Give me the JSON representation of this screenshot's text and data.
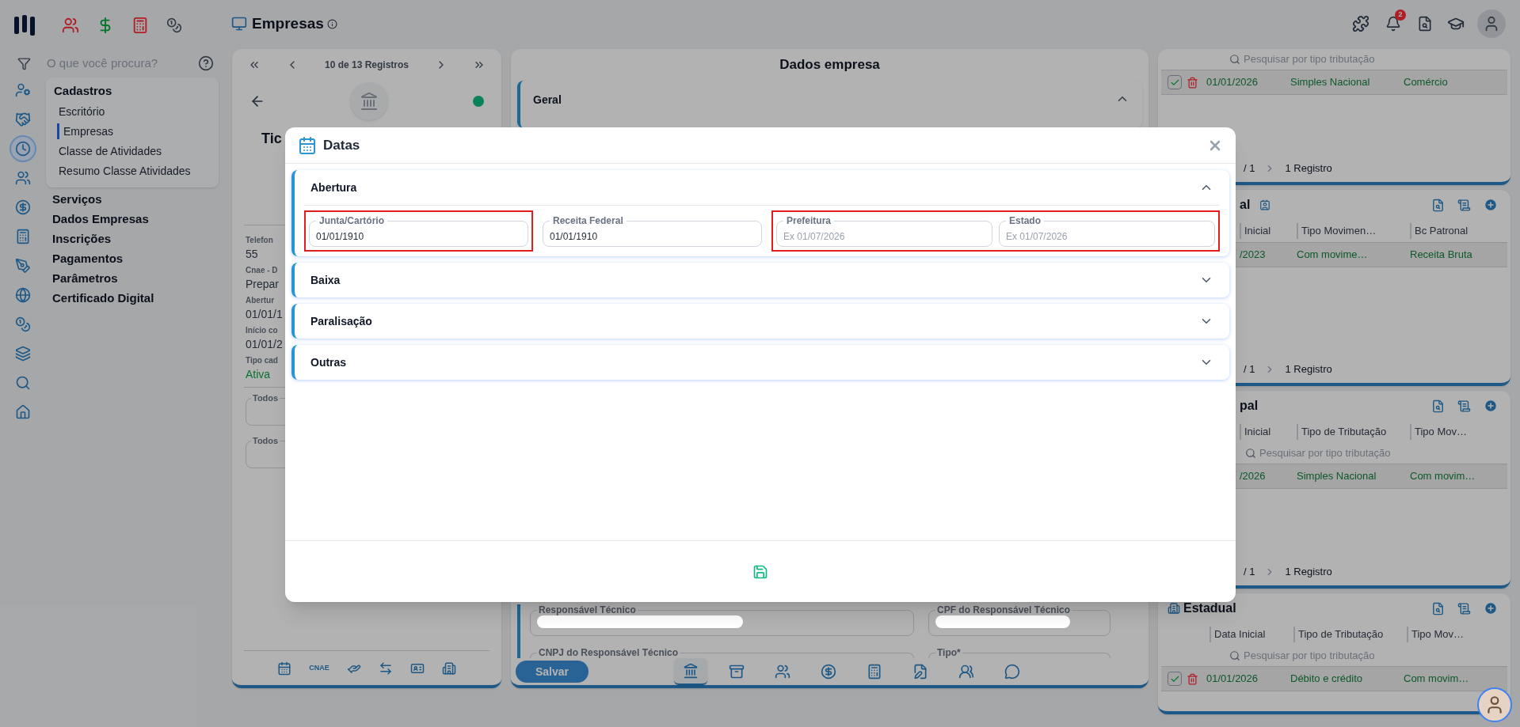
{
  "top_bar": {
    "title": "Empresas",
    "notifications": "2"
  },
  "sidebar": {
    "search_placeholder": "O que você procura?",
    "nav_rail": [
      {
        "kind": "user-gear",
        "selected": false
      },
      {
        "kind": "handshake",
        "selected": false
      },
      {
        "kind": "clock",
        "selected": true
      },
      {
        "kind": "users",
        "selected": false
      },
      {
        "kind": "dollar",
        "selected": false
      },
      {
        "kind": "calculator",
        "selected": false
      },
      {
        "kind": "pen",
        "selected": false
      },
      {
        "kind": "globe",
        "selected": false
      },
      {
        "kind": "coins",
        "selected": false
      },
      {
        "kind": "layers",
        "selected": false
      },
      {
        "kind": "search",
        "selected": false
      },
      {
        "kind": "home",
        "selected": false
      }
    ],
    "menu": [
      {
        "label": "Cadastros",
        "expanded": true,
        "children": [
          {
            "label": "Escritório",
            "selected": false
          },
          {
            "label": "Empresas",
            "selected": true
          },
          {
            "label": "Classe de Atividades",
            "selected": false
          },
          {
            "label": "Resumo Classe Atividades",
            "selected": false
          }
        ]
      },
      {
        "label": "Serviços",
        "expanded": false
      },
      {
        "label": "Dados Empresas",
        "expanded": false
      },
      {
        "label": "Inscrições",
        "expanded": false
      },
      {
        "label": "Pagamentos",
        "expanded": false
      },
      {
        "label": "Parâmetros",
        "expanded": false
      },
      {
        "label": "Certificado Digital",
        "expanded": false
      }
    ]
  },
  "record_panel": {
    "pager": "10 de 13 Registros",
    "active": true,
    "title": "Tic",
    "info": [
      {
        "label": "Telefon",
        "value": "55",
        "kind": "text"
      },
      {
        "label": "Cnae - D",
        "value": "Prepar",
        "kind": "text"
      },
      {
        "label": "Abertur",
        "value": "01/01/1",
        "kind": "text"
      },
      {
        "label": "Início co",
        "value": "01/01/2",
        "kind": "text"
      },
      {
        "label": "Tipo cad",
        "value": "Ativa",
        "kind": "status"
      }
    ],
    "filters": [
      "Todos",
      "Todos"
    ],
    "toolbar": [
      {
        "kind": "calendar"
      },
      {
        "kind": "text",
        "label": "CNAE"
      },
      {
        "kind": "hand"
      },
      {
        "kind": "transfer"
      },
      {
        "kind": "card"
      },
      {
        "kind": "building"
      }
    ]
  },
  "main_panel": {
    "title": "Dados empresa",
    "sections": [
      {
        "title": "Geral",
        "expanded": true
      }
    ],
    "fields": [
      {
        "label": "Responsável Técnico",
        "redacted": true
      },
      {
        "label": "CPF do Responsável Técnico",
        "redacted": true
      },
      {
        "label": "CNPJ do Responsável Técnico",
        "redacted": false
      },
      {
        "label": "Tipo*",
        "redacted": false
      }
    ],
    "save_button": "Salvar",
    "tabs": [
      {
        "kind": "bank",
        "selected": true
      },
      {
        "kind": "register",
        "selected": false
      },
      {
        "kind": "users",
        "selected": false
      },
      {
        "kind": "dollar",
        "selected": false
      },
      {
        "kind": "calculator",
        "selected": false
      },
      {
        "kind": "doc",
        "selected": false
      },
      {
        "kind": "group",
        "selected": false
      },
      {
        "kind": "chat",
        "selected": false
      }
    ]
  },
  "right_panels": [
    {
      "search_placeholder": "Pesquisar por tipo tributação",
      "rows": [
        {
          "checked": true,
          "cells": [
            "01/01/2026",
            "Simples Nacional",
            "Comércio"
          ]
        }
      ],
      "pages": "/ 1",
      "count": "1 Registro"
    },
    {
      "title": "al",
      "columns": [
        "Inicial",
        "Tipo Movimen…",
        "Bc Patronal"
      ],
      "rows": [
        {
          "cells": [
            "/2023",
            "Com movime…",
            "Receita Bruta"
          ]
        }
      ],
      "pages": "/ 1",
      "count": "1 Registro"
    },
    {
      "title": "pal",
      "columns": [
        "Inicial",
        "Tipo de Tributação",
        "Tipo Mov…"
      ],
      "search_placeholder": "Pesquisar por tipo tributação",
      "rows": [
        {
          "cells": [
            "/2026",
            "Simples Nacional",
            "Com movim…"
          ]
        }
      ],
      "pages": "/ 1",
      "count": "1 Registro"
    },
    {
      "title": "Estadual",
      "columns": [
        "Data Inicial",
        "Tipo de Tributação",
        "Tipo Mov…"
      ],
      "search_placeholder": "Pesquisar por tipo tributação",
      "rows": [
        {
          "checked": true,
          "cells": [
            "01/01/2026",
            "Débito e crédito",
            "Com movim…"
          ]
        }
      ]
    }
  ],
  "dialog": {
    "title": "Datas",
    "sections": [
      {
        "title": "Abertura",
        "expanded": true,
        "field_groups": [
          {
            "highlighted": true,
            "fields": [
              {
                "label": "Junta/Cartório",
                "value": "01/01/1910"
              }
            ]
          },
          {
            "highlighted": false,
            "fields": [
              {
                "label": "Receita Federal",
                "value": "01/01/1910"
              }
            ]
          },
          {
            "highlighted": true,
            "fields": [
              {
                "label": "Prefeitura",
                "placeholder": "Ex 01/07/2026"
              },
              {
                "label": "Estado",
                "placeholder": "Ex 01/07/2026"
              }
            ]
          }
        ]
      },
      {
        "title": "Baixa",
        "expanded": false
      },
      {
        "title": "Paralisação",
        "expanded": false
      },
      {
        "title": "Outras",
        "expanded": false
      }
    ]
  }
}
